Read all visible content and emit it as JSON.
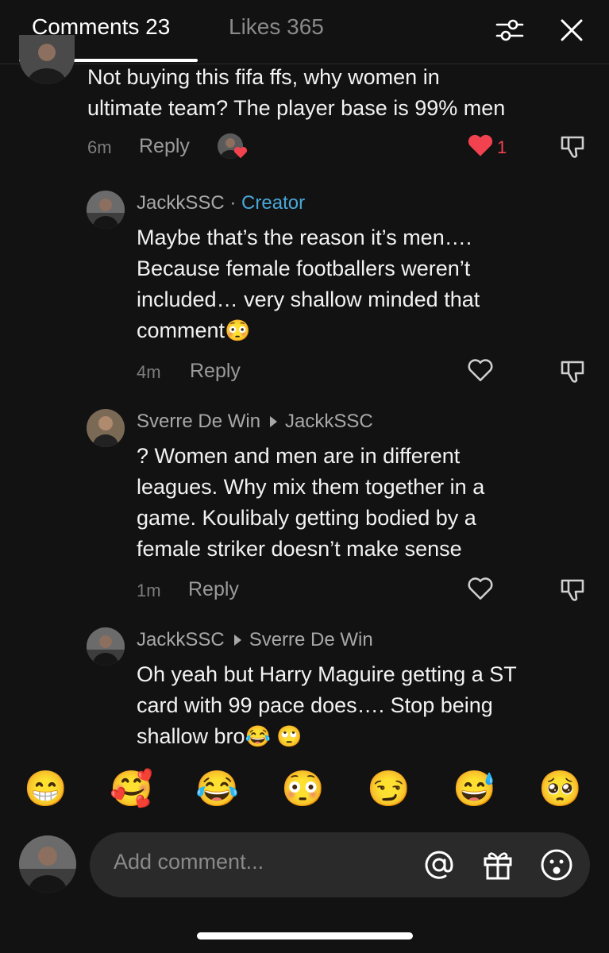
{
  "header": {
    "tab_comments": "Comments 23",
    "tab_likes": "Likes 365"
  },
  "top_comment": {
    "text_line1": "Not buying this fifa ffs, why women in",
    "text_line2": "ultimate team? The player base is 99% men",
    "time": "6m",
    "reply": "Reply",
    "like_count": "1"
  },
  "replies": [
    {
      "user": "JackkSSC",
      "separator": "·",
      "badge": "Creator",
      "lines": [
        "Maybe that’s the reason it’s men….",
        "Because female footballers weren’t",
        "included… very shallow minded that",
        "comment"
      ],
      "line4_emoji": "😳",
      "time": "4m",
      "reply": "Reply"
    },
    {
      "user": "Sverre De Win",
      "reply_to": "JackkSSC",
      "lines": [
        "? Women and men are in different",
        "leagues. Why mix them together in a",
        "game. Koulibaly getting bodied by a",
        "female striker doesn’t make sense"
      ],
      "time": "1m",
      "reply": "Reply"
    },
    {
      "user": "JackkSSC",
      "reply_to": "Sverre De Win",
      "lines": [
        "Oh yeah but Harry Maguire getting a ST",
        "card with 99 pace does…. Stop being",
        "shallow bro"
      ],
      "line3_emoji": "😂 🙄"
    }
  ],
  "emoji_bar": [
    "😁",
    "🥰",
    "😂",
    "😳",
    "😏",
    "😅",
    "🥺"
  ],
  "input": {
    "placeholder": "Add comment..."
  },
  "icons": {
    "filter": "filter-sliders-icon",
    "close": "close-icon",
    "heart_filled_color": "#f2424f",
    "creator_color": "#4aa7d8"
  }
}
